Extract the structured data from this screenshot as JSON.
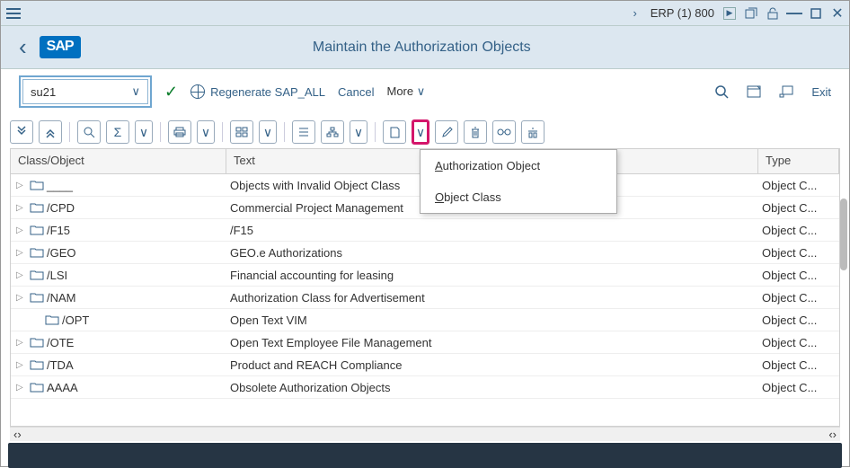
{
  "titlebar": {
    "system": "ERP (1) 800"
  },
  "header": {
    "title": "Maintain the Authorization Objects",
    "logo": "SAP"
  },
  "actionbar": {
    "tcode": "su21",
    "regenerate": "Regenerate SAP_ALL",
    "cancel": "Cancel",
    "more": "More",
    "exit": "Exit"
  },
  "dropdown": {
    "item1_pre": "A",
    "item1_rest": "uthorization Object",
    "item2_pre": "O",
    "item2_rest": "bject Class"
  },
  "grid": {
    "h1": "Class/Object",
    "h2": "Text",
    "h3": "Type",
    "rows": [
      {
        "name": "____",
        "text": "Objects with Invalid Object Class",
        "type": "Object C...",
        "exp": true,
        "i": 0
      },
      {
        "name": "/CPD",
        "text": "Commercial Project Management",
        "type": "Object C...",
        "exp": true,
        "i": 0
      },
      {
        "name": "/F15",
        "text": "/F15",
        "type": "Object C...",
        "exp": true,
        "i": 0
      },
      {
        "name": "/GEO",
        "text": "GEO.e Authorizations",
        "type": "Object C...",
        "exp": true,
        "i": 0
      },
      {
        "name": "/LSI",
        "text": "Financial accounting for leasing",
        "type": "Object C...",
        "exp": true,
        "i": 0
      },
      {
        "name": "/NAM",
        "text": "Authorization Class for Advertisement",
        "type": "Object C...",
        "exp": true,
        "i": 0
      },
      {
        "name": "/OPT",
        "text": "Open Text VIM",
        "type": "Object C...",
        "exp": false,
        "i": 1
      },
      {
        "name": "/OTE",
        "text": "Open Text Employee File Management",
        "type": "Object C...",
        "exp": true,
        "i": 0
      },
      {
        "name": "/TDA",
        "text": "Product and REACH Compliance",
        "type": "Object C...",
        "exp": true,
        "i": 0
      },
      {
        "name": "AAAA",
        "text": "Obsolete Authorization Objects",
        "type": "Object C...",
        "exp": true,
        "i": 0
      }
    ]
  }
}
